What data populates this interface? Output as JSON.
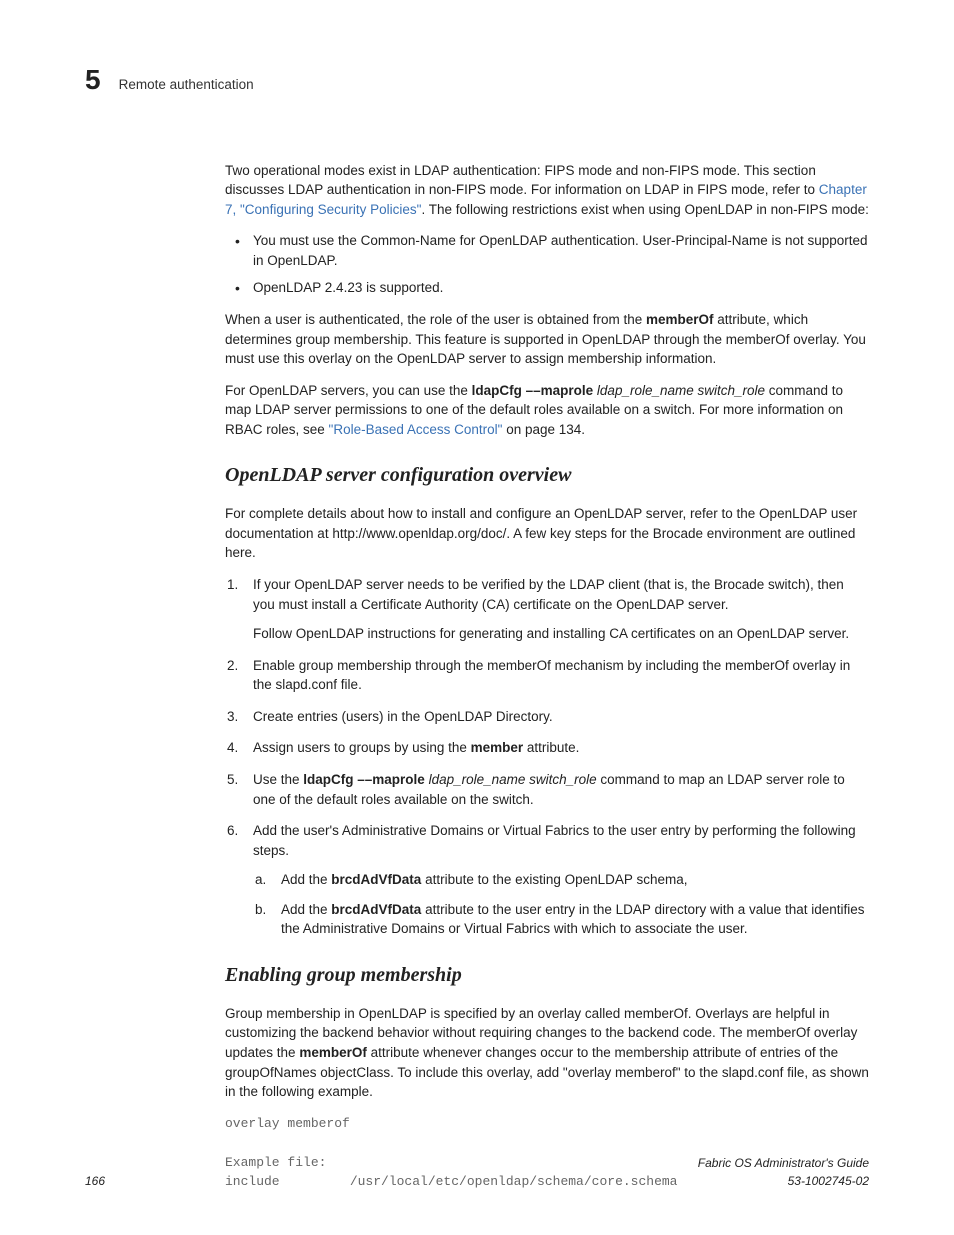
{
  "header": {
    "chapter": "5",
    "title": "Remote authentication"
  },
  "p1_a": "Two operational modes exist in LDAP authentication: FIPS mode and non-FIPS mode. This section discusses LDAP authentication in non-FIPS mode. For information on LDAP in FIPS mode, refer to ",
  "p1_link": "Chapter 7, \"Configuring Security Policies\"",
  "p1_b": ". The following restrictions exist when using OpenLDAP in non-FIPS mode:",
  "bullets": [
    "You must use the Common-Name for OpenLDAP authentication. User-Principal-Name is not supported in OpenLDAP.",
    "OpenLDAP 2.4.23 is supported."
  ],
  "p2_a": "When a user is authenticated, the role of the user is obtained from the ",
  "p2_bold": "memberOf",
  "p2_b": " attribute, which determines group membership. This feature is supported in OpenLDAP through the memberOf overlay. You must use this overlay on the OpenLDAP server to assign membership information.",
  "p3_a": "For OpenLDAP servers, you can use the ",
  "p3_cmd": "ldapCfg ––maprole",
  "p3_args": " ldap_role_name switch_role",
  "p3_b": " command to map LDAP server permissions to one of the default roles available on a switch. For more information on RBAC roles, see ",
  "p3_link": "\"Role-Based Access Control\"",
  "p3_c": " on page 134.",
  "h2a": "OpenLDAP server configuration overview",
  "p4": "For complete details about how to install and configure an OpenLDAP server, refer to the OpenLDAP user documentation at http://www.openldap.org/doc/. A few key steps for the Brocade environment are outlined here.",
  "ol": {
    "i1": "If your OpenLDAP server needs to be verified by the LDAP client (that is, the Brocade switch), then you must install a Certificate Authority (CA) certificate on the OpenLDAP server.",
    "i1sub": "Follow OpenLDAP instructions for generating and installing CA certificates on an OpenLDAP server.",
    "i2": "Enable group membership through the memberOf mechanism by including the memberOf overlay in the slapd.conf file.",
    "i3": "Create entries (users) in the OpenLDAP Directory.",
    "i4_a": "Assign users to groups by using the ",
    "i4_bold": "member",
    "i4_b": " attribute.",
    "i5_a": "Use the ",
    "i5_cmd": "ldapCfg ––maprole",
    "i5_args": " ldap_role_name switch_role",
    "i5_b": " command to map an LDAP server role to one of the default roles available on the switch.",
    "i6": "Add the user's Administrative Domains or Virtual Fabrics to the user entry by performing the following steps.",
    "i6a_a": "Add the ",
    "i6a_bold": "brcdAdVfData",
    "i6a_b": " attribute to the existing OpenLDAP schema,",
    "i6b_a": "Add the ",
    "i6b_bold": "brcdAdVfData",
    "i6b_b": " attribute to the user entry in the LDAP directory with a value that identifies the Administrative Domains or Virtual Fabrics with which to associate the user."
  },
  "h2b": "Enabling group membership",
  "p5_a": "Group membership in OpenLDAP is specified by an overlay called memberOf. Overlays are helpful in customizing the backend behavior without requiring changes to the backend code. The memberOf overlay updates the ",
  "p5_bold": "memberOf",
  "p5_b": " attribute whenever changes occur to the membership attribute of entries of the groupOfNames objectClass. To include this overlay, add \"overlay memberof\" to the slapd.conf file, as shown in the following example.",
  "code": "overlay memberof\n\nExample file:\ninclude         /usr/local/etc/openldap/schema/core.schema",
  "footer": {
    "page": "166",
    "guide": "Fabric OS Administrator's Guide",
    "docnum": "53-1002745-02"
  }
}
